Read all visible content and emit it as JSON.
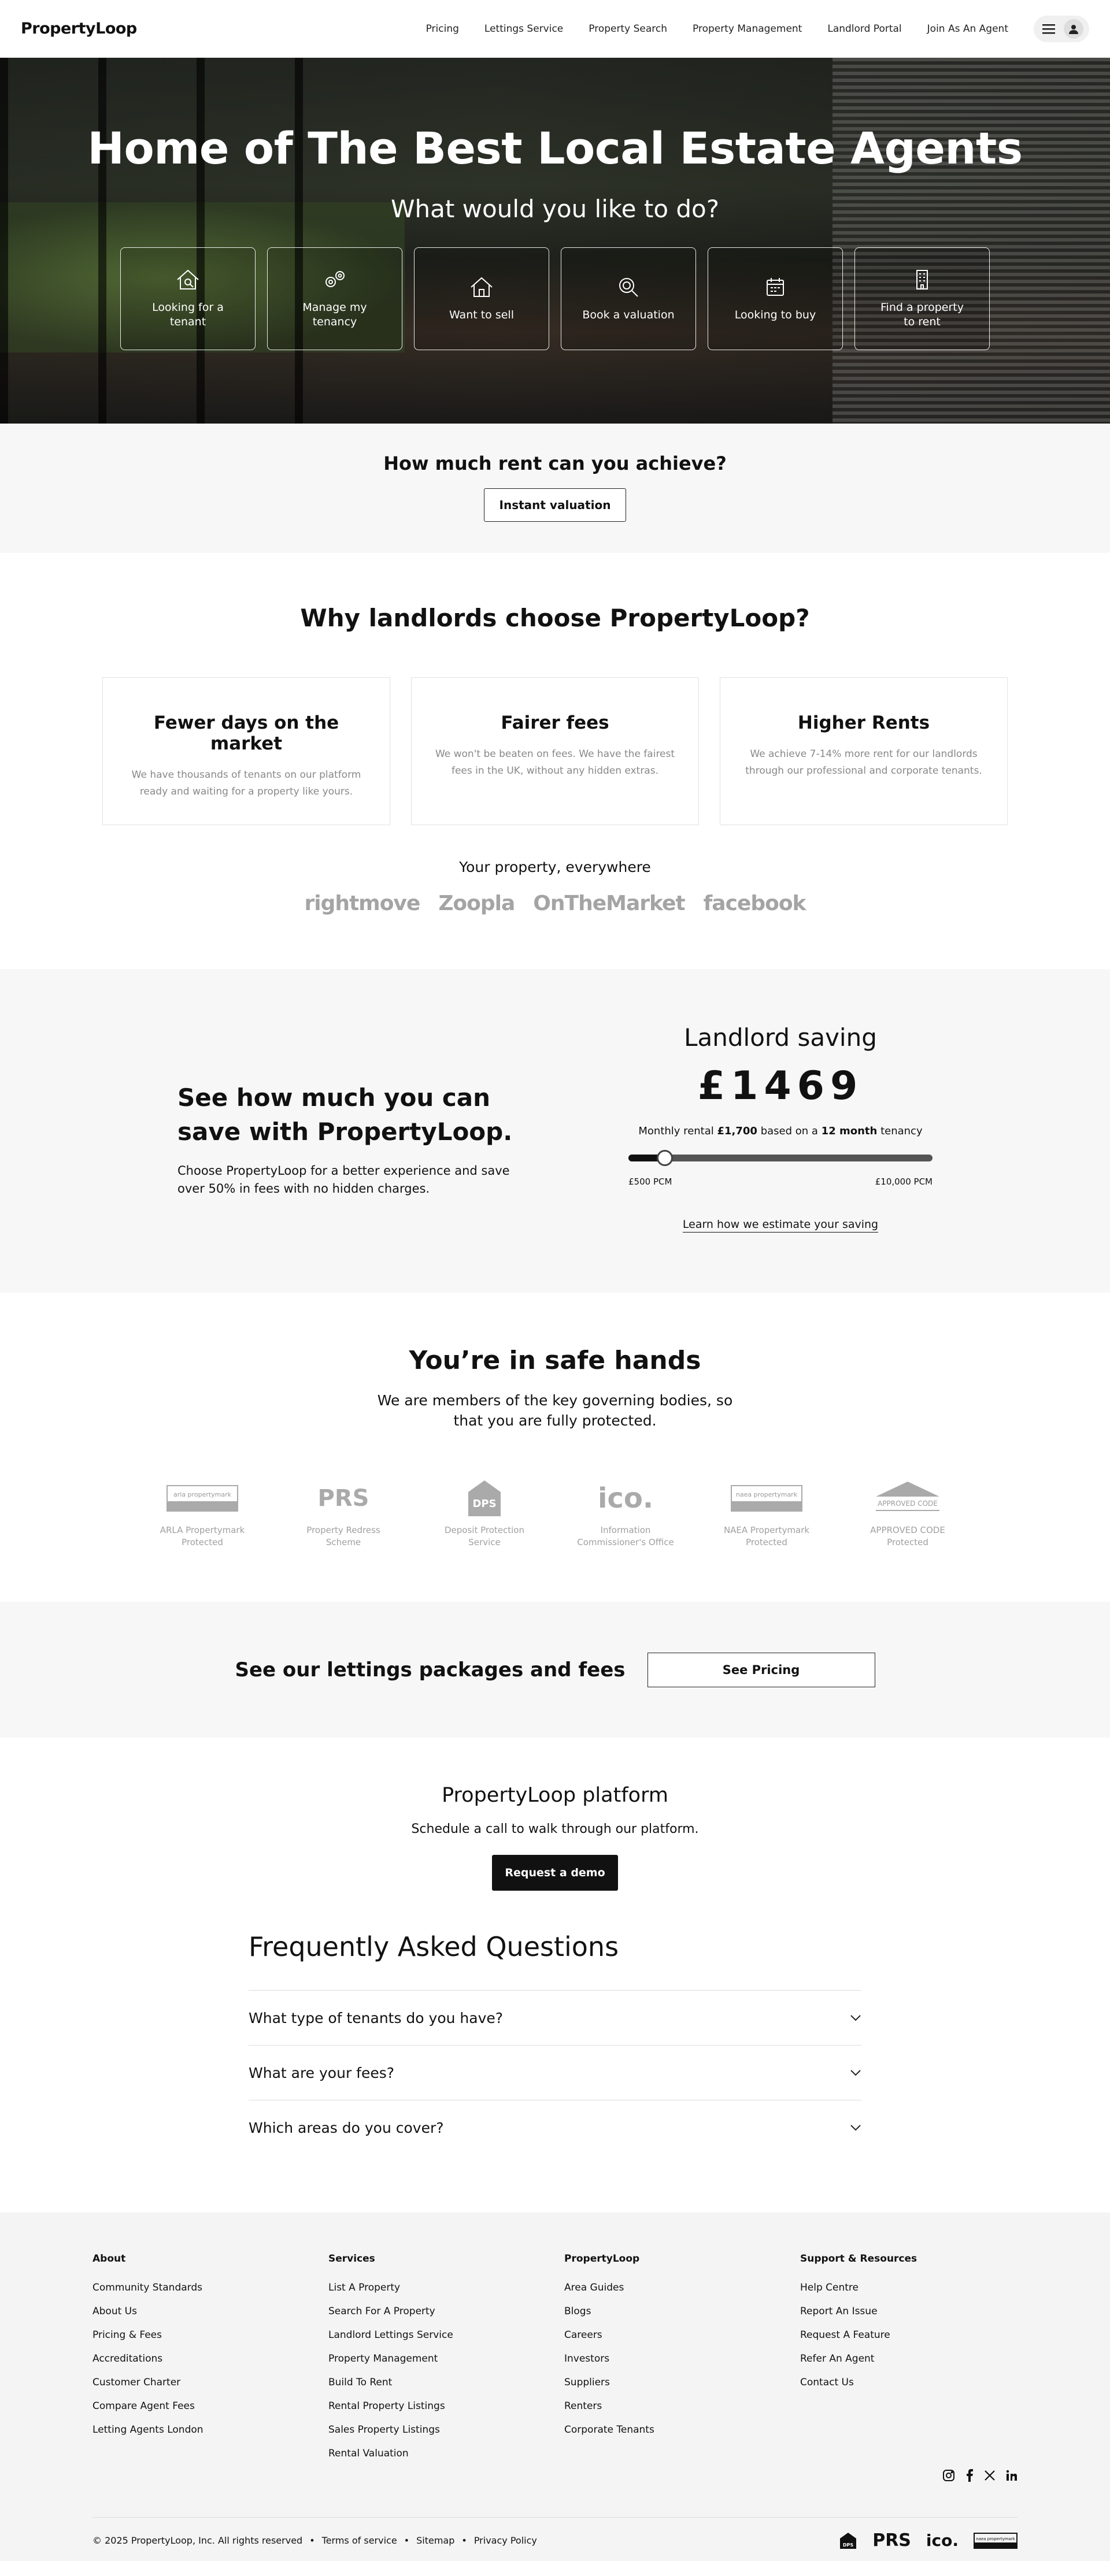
{
  "header": {
    "logo": "PropertyLoop",
    "nav": [
      "Pricing",
      "Lettings Service",
      "Property Search",
      "Property Management",
      "Landlord Portal",
      "Join As An Agent"
    ]
  },
  "hero": {
    "title": "Home of The Best Local Estate Agents",
    "subtitle": "What would you like to do?",
    "tiles": [
      {
        "label": "Looking for a tenant",
        "icon": "house-search-icon"
      },
      {
        "label": "Manage my tenancy",
        "icon": "gears-icon"
      },
      {
        "label": "Want to sell",
        "icon": "house-icon"
      },
      {
        "label": "Book a valuation",
        "icon": "magnifier-icon"
      },
      {
        "label": "Looking to buy",
        "icon": "calendar-icon"
      },
      {
        "label": "Find a property to rent",
        "icon": "building-icon"
      }
    ]
  },
  "rent": {
    "title": "How much rent can you achieve?",
    "button": "Instant valuation"
  },
  "why": {
    "title": "Why landlords choose PropertyLoop?",
    "cards": [
      {
        "title": "Fewer days on the market",
        "text": "We have thousands of tenants on our platform ready and waiting for a property like yours."
      },
      {
        "title": "Fairer fees",
        "text": "We won't be beaten on fees. We have the fairest fees in the UK, without any hidden extras."
      },
      {
        "title": "Higher Rents",
        "text": "We achieve 7-14% more rent for our landlords through our professional and corporate tenants."
      }
    ],
    "everywhere": "Your property, everywhere",
    "portals": [
      "rightmove",
      "Zoopla",
      "OnTheMarket",
      "facebook"
    ]
  },
  "save": {
    "title": "See how much you can save with PropertyLoop.",
    "text": "Choose PropertyLoop for a better experience and save over 50% in fees with no hidden charges.",
    "saving_title": "Landlord saving",
    "amount": "£1469",
    "monthly_prefix": "Monthly rental",
    "monthly_value": "£1,700",
    "monthly_mid": "based on a",
    "monthly_term": "12 month",
    "monthly_suffix": "tenancy",
    "slider_fraction": 0.12,
    "min_label": "£500 PCM",
    "max_label": "£10,000 PCM",
    "learn": "Learn how we estimate your saving"
  },
  "safe": {
    "title": "You’re in safe hands",
    "text": "We are members of the key governing bodies, so that you are fully protected.",
    "badges": [
      {
        "label": "ARLA Propertymark Protected",
        "mark": "arla propertymark"
      },
      {
        "label": "Property Redress Scheme",
        "mark": "PRS"
      },
      {
        "label": "Deposit Protection Service",
        "mark": "DPS"
      },
      {
        "label": "Information Commissioner's Office",
        "mark": "ico."
      },
      {
        "label": "NAEA Propertymark Protected",
        "mark": "naea propertymark"
      },
      {
        "label": "APPROVED CODE Protected",
        "mark": "APPROVED CODE"
      }
    ]
  },
  "pricing": {
    "title": "See our lettings packages and fees",
    "button": "See Pricing"
  },
  "platform": {
    "title": "PropertyLoop platform",
    "text": "Schedule a call to walk through our platform.",
    "button": "Request a demo"
  },
  "faq": {
    "title": "Frequently Asked Questions",
    "items": [
      "What type of tenants do you have?",
      "What are your fees?",
      "Which areas do you cover?"
    ]
  },
  "footer": {
    "columns": [
      {
        "title": "About",
        "links": [
          "Community Standards",
          "About Us",
          "Pricing & Fees",
          "Accreditations",
          "Customer Charter",
          "Compare Agent Fees",
          "Letting Agents London"
        ]
      },
      {
        "title": "Services",
        "links": [
          "List A Property",
          "Search For A Property",
          "Landlord Lettings Service",
          "Property Management",
          "Build To Rent",
          "Rental Property Listings",
          "Sales Property Listings",
          "Rental Valuation"
        ]
      },
      {
        "title": "PropertyLoop",
        "links": [
          "Area Guides",
          "Blogs",
          "Careers",
          "Investors",
          "Suppliers",
          "Renters",
          "Corporate Tenants"
        ]
      },
      {
        "title": "Support & Resources",
        "links": [
          "Help Centre",
          "Report An Issue",
          "Request A Feature",
          "Refer An Agent",
          "Contact Us"
        ]
      }
    ],
    "copyright": "© 2025 PropertyLoop, Inc. All rights reserved",
    "legal": [
      "Terms of service",
      "Sitemap",
      "Privacy Policy"
    ],
    "bottom_logos": [
      "DPS",
      "PRS",
      "ico.",
      "naea propertymark"
    ],
    "social": [
      "instagram-icon",
      "facebook-icon",
      "x-icon",
      "linkedin-icon"
    ]
  }
}
